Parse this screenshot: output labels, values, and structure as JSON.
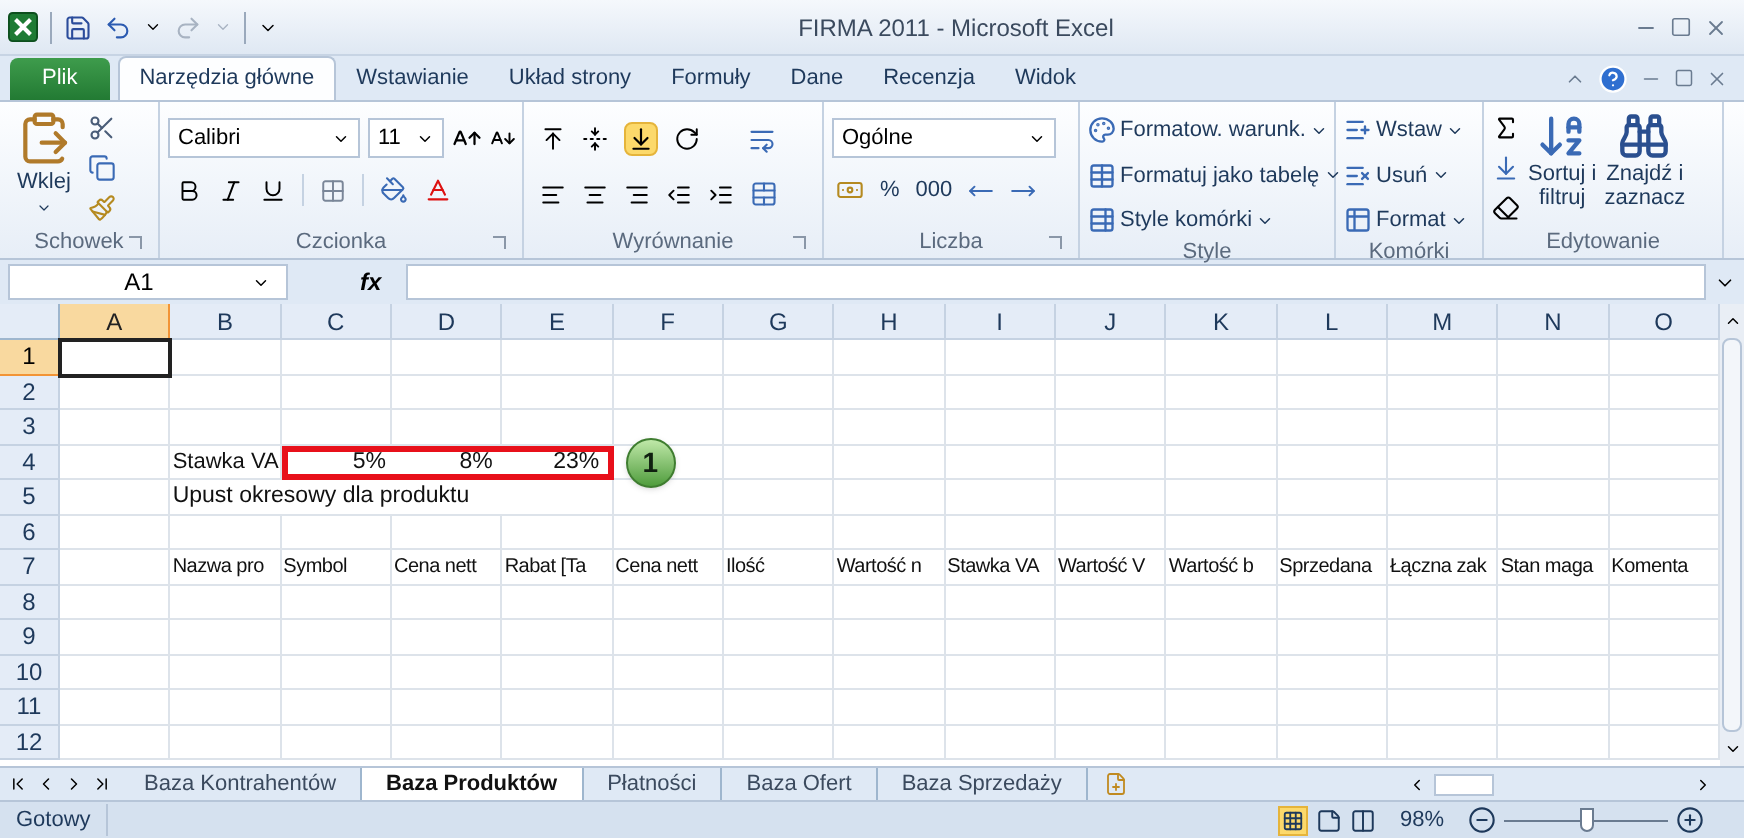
{
  "window": {
    "title": "FIRMA 2011 - Microsoft Excel"
  },
  "ribbon_tabs": [
    {
      "label": "Plik",
      "kind": "file",
      "selected": false
    },
    {
      "label": "Narzędzia główne",
      "kind": "tab",
      "selected": true
    },
    {
      "label": "Wstawianie",
      "kind": "tab",
      "selected": false
    },
    {
      "label": "Układ strony",
      "kind": "tab",
      "selected": false
    },
    {
      "label": "Formuły",
      "kind": "tab",
      "selected": false
    },
    {
      "label": "Dane",
      "kind": "tab",
      "selected": false
    },
    {
      "label": "Recenzja",
      "kind": "tab",
      "selected": false
    },
    {
      "label": "Widok",
      "kind": "tab",
      "selected": false
    }
  ],
  "ribbon": {
    "clipboard": {
      "label": "Schowek",
      "paste": "Wklej"
    },
    "font": {
      "label": "Czcionka",
      "family": "Calibri",
      "size": "11"
    },
    "alignment": {
      "label": "Wyrównanie"
    },
    "number": {
      "label": "Liczba",
      "format": "Ogólne",
      "percent": "%",
      "thousands": "000"
    },
    "styles": {
      "label": "Style",
      "buttons": [
        "Formatow. warunk.",
        "Formatuj jako tabelę",
        "Style komórki"
      ]
    },
    "cells": {
      "label": "Komórki",
      "buttons": [
        "Wstaw",
        "Usuń",
        "Format"
      ]
    },
    "editing": {
      "label": "Edytowanie",
      "sort": [
        "Sortuj i",
        "filtruj"
      ],
      "find": [
        "Znajdź i",
        "zaznacz"
      ]
    }
  },
  "formula_bar": {
    "name_box": "A1",
    "function_label": "fx"
  },
  "sheet": {
    "columns": [
      {
        "label": "A",
        "selected": true
      },
      {
        "label": "B",
        "selected": false
      },
      {
        "label": "C",
        "selected": false
      },
      {
        "label": "D",
        "selected": false
      },
      {
        "label": "E",
        "selected": false
      },
      {
        "label": "F",
        "selected": false
      },
      {
        "label": "G",
        "selected": false
      },
      {
        "label": "H",
        "selected": false
      },
      {
        "label": "I",
        "selected": false
      },
      {
        "label": "J",
        "selected": false
      },
      {
        "label": "K",
        "selected": false
      },
      {
        "label": "L",
        "selected": false
      },
      {
        "label": "M",
        "selected": false
      },
      {
        "label": "N",
        "selected": false
      },
      {
        "label": "O",
        "selected": false
      }
    ],
    "rows": [
      {
        "number": "1",
        "selected": true,
        "kind": "blank"
      },
      {
        "number": "2",
        "selected": false,
        "kind": "blank"
      },
      {
        "number": "3",
        "selected": false,
        "kind": "blank"
      },
      {
        "number": "4",
        "selected": false,
        "kind": "rates",
        "label": "Stawka VA",
        "values": [
          "5%",
          "8%",
          "23%"
        ],
        "callout": "1"
      },
      {
        "number": "5",
        "selected": false,
        "kind": "note",
        "text": "Upust okresowy dla produktu"
      },
      {
        "number": "6",
        "selected": false,
        "kind": "blank"
      },
      {
        "number": "7",
        "selected": false,
        "kind": "headers",
        "cells": [
          "Nazwa pro",
          "Symbol",
          "Cena nett",
          "Rabat  [Ta",
          "Cena nett",
          "Ilość",
          "Wartość n",
          "Stawka VA",
          "Wartość V",
          "Wartość b",
          "Sprzedana",
          "Łączna zak",
          "Stan maga",
          "Komenta"
        ]
      },
      {
        "number": "8",
        "selected": false,
        "kind": "blank"
      },
      {
        "number": "9",
        "selected": false,
        "kind": "blank"
      },
      {
        "number": "10",
        "selected": false,
        "kind": "blank"
      },
      {
        "number": "11",
        "selected": false,
        "kind": "blank"
      },
      {
        "number": "12",
        "selected": false,
        "kind": "blank"
      }
    ]
  },
  "sheet_tabs": [
    {
      "label": "Baza Kontrahentów",
      "selected": false
    },
    {
      "label": "Baza Produktów",
      "selected": true
    },
    {
      "label": "Płatności",
      "selected": false
    },
    {
      "label": "Baza Ofert",
      "selected": false
    },
    {
      "label": "Baza Sprzedaży",
      "selected": false
    }
  ],
  "status_bar": {
    "status": "Gotowy",
    "zoom": "98%",
    "zoom_slider": {
      "level": 0.5
    }
  }
}
